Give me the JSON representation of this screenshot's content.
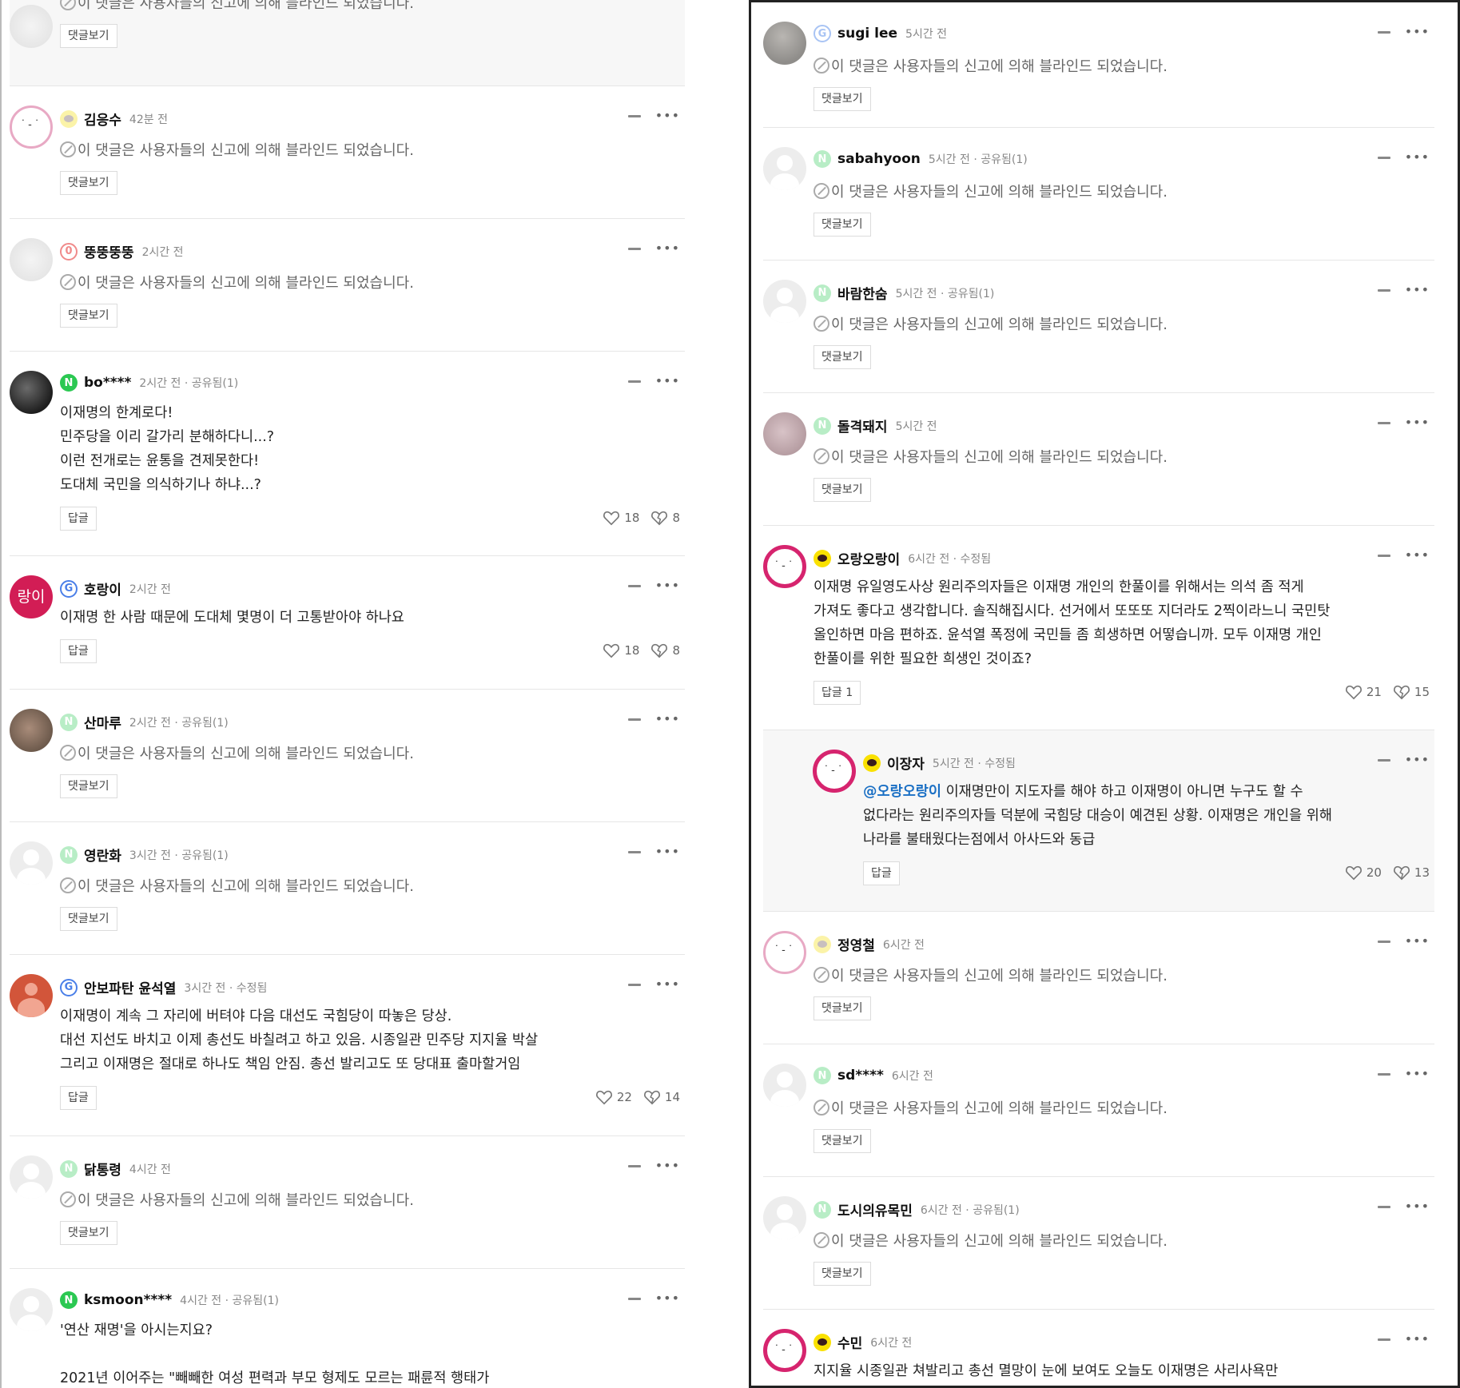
{
  "blinded_text": "이 댓글은 사용자들의 신고에 의해 블라인드 되었습니다.",
  "view_replies_label": "댓글보기",
  "reply_label": "답글",
  "left_comments": [
    {
      "username": "",
      "meta": "",
      "blinded": true
    },
    {
      "username": "김응수",
      "meta": "42분 전",
      "blinded": true
    },
    {
      "username": "뚱뚱뚱뚱",
      "meta": "2시간 전",
      "blinded": true
    },
    {
      "username": "bo****",
      "meta": "2시간 전 · 공유됨(1)",
      "blinded": false,
      "body": "이재명의 한계로다!\n민주당을 이리 갈가리 분해하다니...?\n이런 전개로는 윤통을 견제못한다!\n도대체 국민을 의식하기나 하냐...?",
      "likes": "18",
      "dislikes": "8"
    },
    {
      "username": "호랑이",
      "avatar_text": "랑이",
      "meta": "2시간 전",
      "blinded": false,
      "body": "이재명 한 사람 때문에 도대체 몇명이 더 고통받아야 하나요",
      "likes": "18",
      "dislikes": "8"
    },
    {
      "username": "산마루",
      "meta": "2시간 전 · 공유됨(1)",
      "blinded": true
    },
    {
      "username": "영란화",
      "meta": "3시간 전 · 공유됨(1)",
      "blinded": true
    },
    {
      "username": "안보파탄 윤석열",
      "meta": "3시간 전 · 수정됨",
      "blinded": false,
      "body": "이재명이 계속 그 자리에 버텨야 다음 대선도 국힘당이 따놓은 당상.\n대선 지선도 바치고 이제 총선도 바칠려고 하고 있음. 시종일관 민주당 지지율 박살\n그리고 이재명은 절대로 하나도 책임 안짐. 총선 발리고도 또 당대표 출마할거임",
      "likes": "22",
      "dislikes": "14"
    },
    {
      "username": "닭통령",
      "meta": "4시간 전",
      "blinded": true
    },
    {
      "username": "ksmoon****",
      "meta": "4시간 전 · 공유됨(1)",
      "blinded": false,
      "body": "'연산 재명'을 아시는지요?\n\n2021년 이어주는 \"빼빼한 여성 편력과 부모 형제도 모르는 패륜적 행태가"
    }
  ],
  "right_comments": [
    {
      "username": "sugi lee",
      "meta": "5시간 전",
      "blinded": true
    },
    {
      "username": "sabahyoon",
      "meta": "5시간 전 · 공유됨(1)",
      "blinded": true
    },
    {
      "username": "바람한숨",
      "meta": "5시간 전 · 공유됨(1)",
      "blinded": true
    },
    {
      "username": "돌격돼지",
      "meta": "5시간 전",
      "blinded": true
    },
    {
      "username": "오랑오랑이",
      "meta": "6시간 전 · 수정됨",
      "blinded": false,
      "body": "이재명 유일영도사상 원리주의자들은 이재명 개인의 한풀이를 위해서는 의석 좀 적게\n가져도 좋다고 생각합니다. 솔직해집시다. 선거에서 또또또 지더라도 2찍이라느니 국민탓\n올인하면 마음 편하죠. 윤석열 폭정에 국민들 좀 희생하면 어떻습니까. 모두 이재명 개인\n한풀이를 위한 필요한 희생인 것이죠?",
      "reply_btn": "답글 1",
      "likes": "21",
      "dislikes": "15"
    },
    {
      "username": "이장자",
      "meta": "5시간 전 · 수정됨",
      "blinded": false,
      "mention": "@오랑오랑이",
      "body_first": " 이재명만이 지도자를 해야 하고 이재명이 아니면 누구도 할 수",
      "body_rest": "없다라는 원리주의자들 덕분에 국힘당 대승이 예견된 상황. 이재명은 개인을 위해\n나라를 불태웠다는점에서 아사드와 동급",
      "likes": "20",
      "dislikes": "13"
    },
    {
      "username": "정영철",
      "meta": "6시간 전",
      "blinded": true
    },
    {
      "username": "sd****",
      "meta": "6시간 전",
      "blinded": true
    },
    {
      "username": "도시의유목민",
      "meta": "6시간 전 · 공유됨(1)",
      "blinded": true
    },
    {
      "username": "수민",
      "meta": "6시간 전",
      "blinded": false,
      "body": "지지율 시종일관 쳐발리고 총선 멸망이 눈에 보여도 오늘도 이재명은 사리사욕만"
    }
  ]
}
